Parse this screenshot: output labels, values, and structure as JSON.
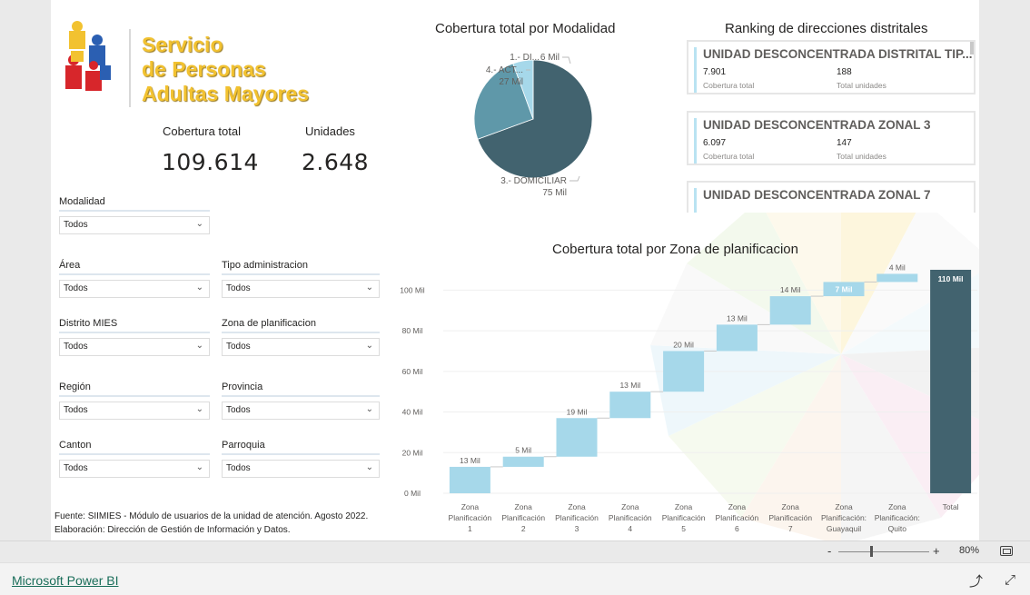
{
  "logo": {
    "line1": "Servicio",
    "line2": "de Personas",
    "line3": "Adultas Mayores"
  },
  "kpis": {
    "cobertura_label": "Cobertura total",
    "cobertura_value": "109.614",
    "unidades_label": "Unidades",
    "unidades_value": "2.648"
  },
  "slicers": {
    "modalidad": {
      "title": "Modalidad",
      "value": "Todos"
    },
    "area": {
      "title": "Área",
      "value": "Todos"
    },
    "tipo_administracion": {
      "title": "Tipo administracion",
      "value": "Todos"
    },
    "distrito": {
      "title": "Distrito MIES",
      "value": "Todos"
    },
    "zona": {
      "title": "Zona de planificacion",
      "value": "Todos"
    },
    "region": {
      "title": "Región",
      "value": "Todos"
    },
    "provincia": {
      "title": "Provincia",
      "value": "Todos"
    },
    "canton": {
      "title": "Canton",
      "value": "Todos"
    },
    "parroquia": {
      "title": "Parroquia",
      "value": "Todos"
    }
  },
  "pie": {
    "title": "Cobertura total por Modalidad",
    "labels": [
      {
        "line1": "1.- DI...",
        "line2": "6 Mil"
      },
      {
        "line1": "4.- ACT...",
        "line2": "27 Mil"
      },
      {
        "line1": "3.- DOMICILIAR",
        "line2": "75 Mil"
      }
    ]
  },
  "ranking": {
    "title": "Ranking de direcciones distritales",
    "cards": [
      {
        "name": "UNIDAD DESCONCENTRADA DISTRITAL TIP...",
        "cobertura": "7.901",
        "unidades": "188",
        "cobertura_label": "Cobertura total",
        "unidades_label": "Total unidades"
      },
      {
        "name": "UNIDAD DESCONCENTRADA ZONAL 3",
        "cobertura": "6.097",
        "unidades": "147",
        "cobertura_label": "Cobertura total",
        "unidades_label": "Total unidades"
      },
      {
        "name": "UNIDAD DESCONCENTRADA ZONAL 7",
        "cobertura": "",
        "unidades": "",
        "cobertura_label": "",
        "unidades_label": ""
      }
    ]
  },
  "waterfall_title": "Cobertura total por Zona de planificacion",
  "chart_data": [
    {
      "type": "pie",
      "title": "Cobertura total por Modalidad",
      "categories": [
        "1.- DI...",
        "4.- ACT...",
        "3.- DOMICILIAR"
      ],
      "values": [
        6,
        27,
        75
      ],
      "unit": "Mil",
      "colors": [
        "#a6d8ea",
        "#5f98a9",
        "#42636f"
      ]
    },
    {
      "type": "bar",
      "subtype": "waterfall",
      "title": "Cobertura total por Zona de planificacion",
      "categories": [
        [
          "Zona",
          "Planificación",
          "1"
        ],
        [
          "Zona",
          "Planificación",
          "2"
        ],
        [
          "Zona",
          "Planificación",
          "3"
        ],
        [
          "Zona",
          "Planificación",
          "4"
        ],
        [
          "Zona",
          "Planificación",
          "5"
        ],
        [
          "Zona",
          "Planificación",
          "6"
        ],
        [
          "Zona",
          "Planificación",
          "7"
        ],
        [
          "Zona",
          "Planificación:",
          "Guayaquil"
        ],
        [
          "Zona",
          "Planificación:",
          "Quito"
        ],
        [
          "Total"
        ]
      ],
      "values": [
        13,
        5,
        19,
        13,
        20,
        13,
        14,
        7,
        4,
        110
      ],
      "data_labels": [
        "13 Mil",
        "5 Mil",
        "19 Mil",
        "13 Mil",
        "20 Mil",
        "13 Mil",
        "14 Mil",
        "7 Mil",
        "4 Mil",
        "110 Mil"
      ],
      "y_ticks": [
        "0 Mil",
        "20 Mil",
        "40 Mil",
        "60 Mil",
        "80 Mil",
        "100 Mil"
      ],
      "ylim": [
        0,
        110
      ],
      "colors": {
        "increase": "#a6d8ea",
        "total": "#42636f"
      },
      "grid": true
    }
  ],
  "footer": {
    "line1": "Fuente: SIIMIES - Módulo de usuarios de la unidad de atención. Agosto 2022.",
    "line2": "Elaboración: Dirección de Gestión de Información y Datos."
  },
  "statusbar": {
    "zoom": "80%",
    "minus": "-",
    "plus": "+"
  },
  "bottombar": {
    "link": "Microsoft Power BI"
  },
  "icons": [
    "fit-to-page-icon",
    "share-icon",
    "expand-icon",
    "chevron-down-icon"
  ]
}
